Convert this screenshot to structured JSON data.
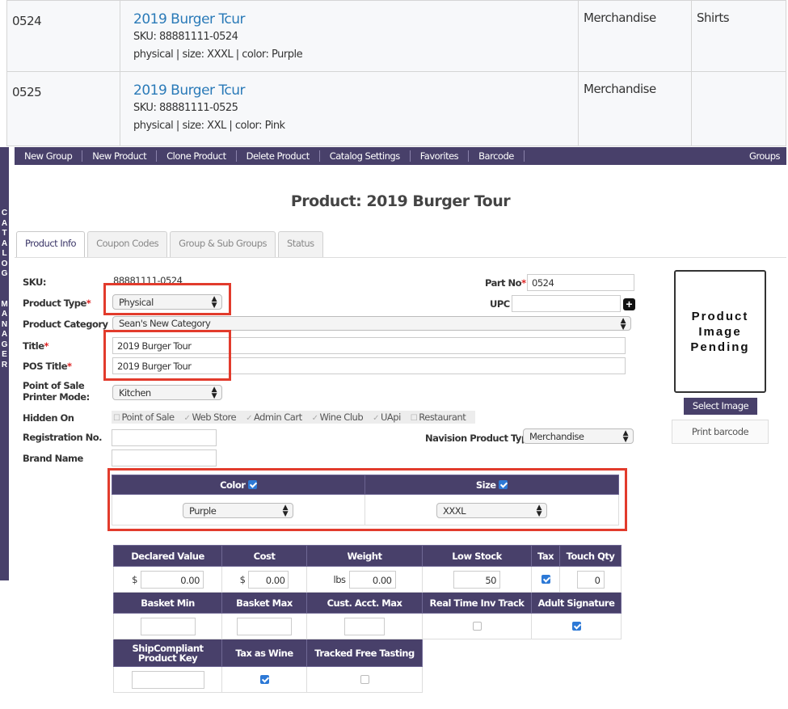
{
  "listing": {
    "rows": [
      {
        "id": "0524",
        "title": "2019 Burger Tcur",
        "sku": "SKU: 88881111-0524",
        "meta": "physical | size: XXXL | color: Purple",
        "category": "Merchandise",
        "subcategory": "Shirts"
      },
      {
        "id": "0525",
        "title": "2019 Burger Tcur",
        "sku": "SKU: 88881111-0525",
        "meta": "physical | size: XXL | color: Pink",
        "category": "Merchandise",
        "subcategory": ""
      }
    ]
  },
  "side_tab": {
    "letters": [
      "C",
      "A",
      "T",
      "A",
      "L",
      "O",
      "G",
      "",
      "",
      "M",
      "A",
      "N",
      "A",
      "G",
      "E",
      "R"
    ]
  },
  "toolbar": {
    "items": [
      "New Group",
      "New Product",
      "Clone Product",
      "Delete Product",
      "Catalog Settings",
      "Favorites",
      "Barcode"
    ],
    "right": "Groups"
  },
  "page_title": "Product: 2019 Burger Tour",
  "tabs": [
    "Product Info",
    "Coupon Codes",
    "Group & Sub Groups",
    "Status"
  ],
  "form": {
    "sku_label": "SKU:",
    "sku_value": "88881111-0524",
    "part_no_label": "Part No",
    "part_no_value": "0524",
    "product_type_label": "Product Type",
    "product_type_value": "Physical",
    "upc_label": "UPC",
    "upc_value": "",
    "category_label": "Product Category",
    "category_value": "Sean's New Category",
    "title_label": "Title",
    "title_value": "2019 Burger Tour",
    "pos_title_label": "POS Title",
    "pos_title_value": "2019 Burger Tour",
    "printer_label_1": "Point of Sale",
    "printer_label_2": "Printer Mode:",
    "printer_value": "Kitchen",
    "hidden_on_label": "Hidden On",
    "hidden_on_options": [
      "Point of Sale",
      "Web Store",
      "Admin Cart",
      "Wine Club",
      "UApi",
      "Restaurant"
    ],
    "registration_label": "Registration No.",
    "brand_label": "Brand Name",
    "navision_label": "Navision Product Type",
    "navision_value": "Merchandise"
  },
  "image_panel": {
    "placeholder_lines": [
      "Product",
      "Image",
      "Pending"
    ],
    "select_label": "Select Image",
    "print_label": "Print barcode"
  },
  "variants": {
    "color_label": "Color",
    "size_label": "Size",
    "color_value": "Purple",
    "size_value": "XXXL"
  },
  "grid": {
    "row1_headers": [
      "Declared Value",
      "Cost",
      "Weight",
      "Low Stock",
      "Tax",
      "Touch Qty"
    ],
    "declared_value": "0.00",
    "cost": "0.00",
    "weight": "0.00",
    "low_stock": "50",
    "touch_qty": "0",
    "unit_dollar": "$",
    "unit_lbs": "lbs",
    "row2_headers": [
      "Basket Min",
      "Basket Max",
      "Cust. Acct. Max",
      "Real Time Inv Track",
      "Adult Signature"
    ],
    "row3_headers": [
      "ShipCompliant Product Key",
      "Tax as Wine",
      "Tracked Free Tasting"
    ]
  },
  "colors": {
    "accent": "#48406a",
    "highlight": "#e23b2c",
    "link": "#2a7ab8"
  }
}
